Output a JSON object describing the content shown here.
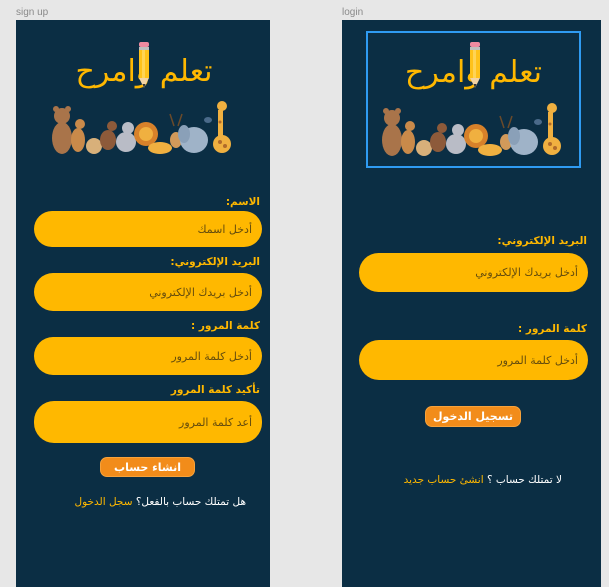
{
  "frames": {
    "signup": {
      "label": "sign up"
    },
    "login": {
      "label": "login"
    }
  },
  "logo": {
    "title": "تعلم وامرح",
    "pencil": "pencil-icon",
    "animals": "animals-illustration"
  },
  "colors": {
    "background": "#0b2e44",
    "accent": "#ffb800",
    "button": "#f28c1a",
    "selection": "#2f9bf2"
  },
  "signup": {
    "name_label": "الاسم:",
    "name_placeholder": "أدخل اسمك",
    "email_label": "البريد الإلكتروني:",
    "email_placeholder": "أدخل بريدك الإلكتروني",
    "password_label": "كلمة المرور :",
    "password_placeholder": "أدخل كلمة المرور",
    "confirm_label": "تأكيد كلمة المرور",
    "confirm_placeholder": "أعد كلمة المرور",
    "submit": "انشاء حساب",
    "have_account": "هل تمتلك حساب بالفعل؟",
    "login_link": "سجل الدخول"
  },
  "login": {
    "email_label": "البريد الإلكتروني:",
    "email_placeholder": "أدخل بريدك الإلكتروني",
    "password_label": "كلمة المرور :",
    "password_placeholder": "أدخل كلمة المرور",
    "submit": "تسجيل الدخول",
    "no_account": "لا تمتلك حساب ؟",
    "create_link": "انشئ حساب جديد"
  }
}
